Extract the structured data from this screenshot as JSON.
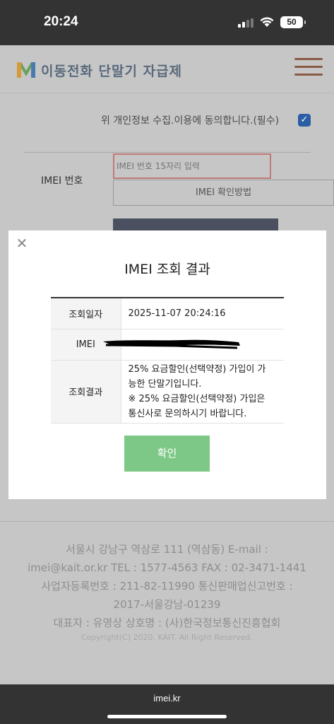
{
  "status_bar": {
    "time": "20:24",
    "battery": "50"
  },
  "site": {
    "logo_text": "이동전화 단말기 자급제",
    "consent_text": "위 개인정보 수집.이용에 동의합니다.(필수)",
    "imei_label": "IMEI 번호",
    "imei_placeholder": "IMEI 번호 15자리 입력",
    "imei_method_label": "IMEI 확인방법"
  },
  "modal": {
    "title": "IMEI 조회 결과",
    "rows": [
      {
        "label": "조회일자",
        "value": "2025-11-07 20:24:16"
      },
      {
        "label": "IMEI",
        "value": ""
      },
      {
        "label": "조회결과",
        "line1": "25% 요금할인(선택약정) 가입이 가",
        "line2": "능한 단말기입니다.",
        "line3": "※ 25% 요금할인(선택약정) 가입은",
        "line4": "통신사로 문의하시기 바랍니다."
      }
    ],
    "confirm_label": "확인"
  },
  "footer": {
    "line1": "서울시 강남구 역삼로 111 (역삼동)      E-mail :",
    "line2": "imei@kait.or.kr      TEL : 1577-4563      FAX : 02-3471-1441",
    "line3": "사업자등록번호 : 211-82-11990      통신판매업신고번호 :",
    "line4": "2017-서울강남-01239",
    "line5": "대표자 : 유영상      상호명 : (사)한국정보통신진흥협회",
    "copyright": "Copyright(C) 2020. KAIT. All Right Reserved."
  },
  "browser": {
    "url": "imei.kr"
  },
  "colors": {
    "dim_background": "#c6c6c6",
    "confirm_button": "#7dc886",
    "checkbox": "#2b5ea4"
  }
}
